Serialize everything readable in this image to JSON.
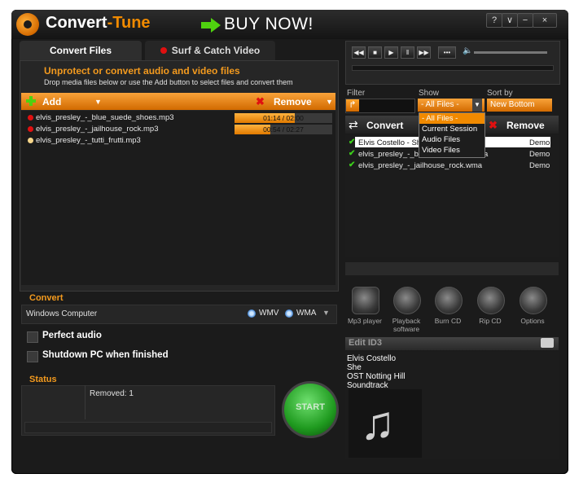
{
  "app": {
    "title_a": "Convert",
    "title_b": "-Tune",
    "buy_now": "BUY NOW!"
  },
  "window_buttons": [
    "?",
    "∨",
    "−",
    "×"
  ],
  "tabs": {
    "convert_files": "Convert Files",
    "surf_catch": "Surf & Catch Video"
  },
  "left": {
    "heading": "Unprotect or convert audio and video files",
    "subheading": "Drop media files below or use the Add button to select files and convert them",
    "add_label": "Add",
    "remove_label": "Remove",
    "files": [
      {
        "name": "elvis_presley_-_blue_suede_shoes.mp3",
        "progress_text": "01:14 / 02:00",
        "progress": 0.62,
        "dot": "#e01010"
      },
      {
        "name": "elvis_presley_-_jailhouse_rock.mp3",
        "progress_text": "00:54 / 02:27",
        "progress": 0.37,
        "dot": "#e01010"
      },
      {
        "name": "elvis_presley_-_tutti_frutti.mp3",
        "progress_text": "",
        "progress": 0,
        "dot": "#f5d58a"
      }
    ],
    "convert": {
      "heading": "Convert",
      "device": "Windows Computer",
      "format_a": "WMV",
      "format_b": "WMA"
    },
    "options": {
      "perfect_audio": "Perfect audio",
      "shutdown": "Shutdown PC when finished"
    },
    "status": {
      "heading": "Status",
      "text": "Removed: 1"
    },
    "start_label": "START"
  },
  "right": {
    "player_buttons": [
      "◀◀",
      "■",
      "▶",
      "‖",
      "▶▶"
    ],
    "filter": {
      "filter_label": "Filter",
      "show_label": "Show",
      "sort_label": "Sort by",
      "show_value": "- All Files -",
      "sort_value": "New Bottom"
    },
    "dropdown_options": [
      "- All Files -",
      "Current Session",
      "Audio Files",
      "Video Files"
    ],
    "convert_label": "Convert",
    "remove_label": "Remove",
    "outputs": [
      {
        "name": "Elvis Costello - She",
        "tag": "Demo"
      },
      {
        "name": "elvis_presley_-_blu",
        "suffix": "a",
        "tag": "Demo"
      },
      {
        "name": "elvis_presley_-_jailhouse_rock.wma",
        "tag": "Demo"
      }
    ],
    "tools": [
      {
        "label": "Mp3 player",
        "icon": "mp3-player-icon"
      },
      {
        "label": "Playback software",
        "icon": "playback-icon"
      },
      {
        "label": "Burn CD",
        "icon": "burn-cd-icon"
      },
      {
        "label": "Rip CD",
        "icon": "rip-cd-icon"
      },
      {
        "label": "Options",
        "icon": "gear-icon"
      }
    ],
    "id3": {
      "heading": "Edit ID3",
      "artist": "Elvis Costello",
      "title": "She",
      "album": "OST Notting Hill",
      "genre": "Soundtrack"
    }
  },
  "colors": {
    "accent": "#f08a00",
    "green": "#4fd10f",
    "red": "#e01010",
    "bg": "#1b1b1b"
  }
}
